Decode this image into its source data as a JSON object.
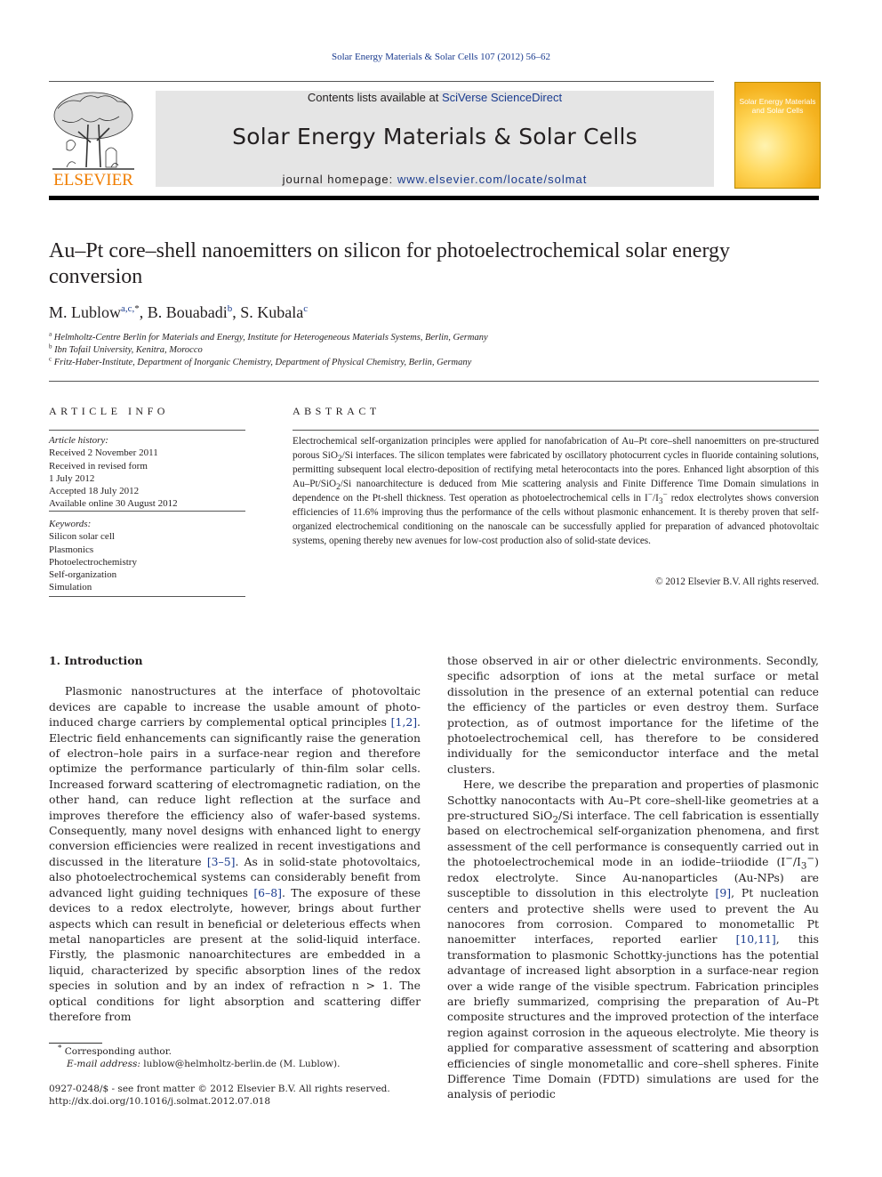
{
  "running_head": "Solar Energy Materials & Solar Cells 107 (2012) 56–62",
  "masthead": {
    "publisher_logo_text": "ELSEVIER",
    "contents_prefix": "Contents lists available at ",
    "contents_link": "SciVerse ScienceDirect",
    "journal_title": "Solar Energy Materials & Solar Cells",
    "homepage_prefix": "journal homepage: ",
    "homepage_link": "www.elsevier.com/locate/solmat",
    "cover_title_line1": "Solar Energy Materials",
    "cover_title_line2": "and Solar Cells"
  },
  "article": {
    "title": "Au–Pt core–shell nanoemitters on silicon for photoelectrochemical solar energy conversion",
    "authors": [
      {
        "name": "M. Lublow",
        "sup": "a,c,",
        "star": "*",
        "sep": ", "
      },
      {
        "name": "B. Bouabadi",
        "sup": "b",
        "star": "",
        "sep": ", "
      },
      {
        "name": "S. Kubala",
        "sup": "c",
        "star": "",
        "sep": ""
      }
    ],
    "affiliations": [
      {
        "mark": "a",
        "text": "Helmholtz-Centre Berlin for Materials and Energy, Institute for Heterogeneous Materials Systems, Berlin, Germany"
      },
      {
        "mark": "b",
        "text": "Ibn Tofail University, Kenitra, Morocco"
      },
      {
        "mark": "c",
        "text": "Fritz-Haber-Institute, Department of Inorganic Chemistry, Department of Physical Chemistry, Berlin, Germany"
      }
    ]
  },
  "article_info": {
    "heading": "ARTICLE INFO",
    "history_label": "Article history:",
    "history": [
      "Received 2 November 2011",
      "Received in revised form",
      "1 July 2012",
      "Accepted 18 July 2012",
      "Available online 30 August 2012"
    ],
    "keywords_label": "Keywords:",
    "keywords": [
      "Silicon solar cell",
      "Plasmonics",
      "Photoelectrochemistry",
      "Self-organization",
      "Simulation"
    ]
  },
  "abstract": {
    "heading": "ABSTRACT",
    "p1": "Electrochemical self-organization principles were applied for nanofabrication of Au–Pt core–shell nanoemitters on pre-structured porous SiO",
    "p2": "/Si interfaces. The silicon templates were fabricated by oscillatory photocurrent cycles in fluoride containing solutions, permitting subsequent local electro-deposition of rectifying metal heterocontacts into the pores. Enhanced light absorption of this Au–Pt/SiO",
    "p3": "/Si nanoarchitecture is deduced from Mie scattering analysis and Finite Difference Time Domain simulations in dependence on the Pt-shell thickness. Test operation as photoelectrochemical cells in I",
    "p4": "/I",
    "p5": " redox electrolytes shows conversion efficiencies of 11.6% improving thus the performance of the cells without plasmonic enhancement. It is thereby proven that self-organized electrochemical conditioning on the nanoscale can be successfully applied for preparation of advanced photovoltaic systems, opening thereby new avenues for low-cost production also of solid-state devices.",
    "sub2": "2",
    "sub3": "3",
    "sup_minus": "−",
    "copyright": "© 2012 Elsevier B.V. All rights reserved."
  },
  "body": {
    "section1_heading": "1.  Introduction",
    "left_p1a": "Plasmonic nanostructures at the interface of photovoltaic devices are capable to increase the usable amount of photo-induced charge carriers by complemental optical principles ",
    "ref_1_2": "[1,2]",
    "left_p1b": ". Electric field enhancements can significantly raise the generation of electron–hole pairs in a surface-near region and therefore optimize the performance particularly of thin-film solar cells. Increased forward scattering of electromagnetic radiation, on the other hand, can reduce light reflection at the surface and improves therefore the efficiency also of wafer-based systems. Consequently, many novel designs with enhanced light to energy conversion efficiencies were realized in recent investigations and discussed in the literature ",
    "ref_3_5": "[3–5]",
    "left_p1c": ". As in solid-state photovoltaics, also photoelectrochemical systems can considerably benefit from advanced light guiding techniques ",
    "ref_6_8": "[6–8]",
    "left_p1d": ". The exposure of these devices to a redox electrolyte, however, brings about further aspects which can result in beneficial or deleterious effects when metal nanoparticles are present at the solid-liquid interface. Firstly, the plasmonic nanoarchitectures are embedded in a liquid, characterized by specific absorption lines of the redox species in solution and by an index of refraction n > 1. The optical conditions for light absorption and scattering differ therefore from",
    "right_p1": "those observed in air or other dielectric environments. Secondly, specific adsorption of ions at the metal surface or metal dissolution in the presence of an external potential can reduce the efficiency of the particles or even destroy them. Surface protection, as of outmost importance for the lifetime of the photoelectrochemical cell, has therefore to be considered individually for the semiconductor interface and the metal clusters.",
    "right_p2a": "Here, we describe the preparation and properties of plasmonic Schottky nanocontacts with Au–Pt core–shell-like geometries at a pre-structured SiO",
    "right_p2b": "/Si interface. The cell fabrication is essentially based on electrochemical self-organization phenomena, and first assessment of the cell performance is consequently carried out in the photoelectrochemical mode in an iodide–triiodide (I",
    "right_p2c": "/I",
    "right_p2d": ") redox electrolyte. Since Au-nanoparticles (Au-NPs) are susceptible to dissolution in this electrolyte ",
    "ref_9": "[9]",
    "right_p2e": ", Pt nucleation centers and protective shells were used to prevent the Au nanocores from corrosion. Compared to monometallic Pt nanoemitter interfaces, reported earlier ",
    "ref_10_11": "[10,11]",
    "right_p2f": ", this transformation to plasmonic Schottky-junctions has the potential advantage of increased light absorption in a surface-near region over a wide range of the visible spectrum. Fabrication principles are briefly summarized, comprising the preparation of Au–Pt composite structures and the improved protection of the interface region against corrosion in the aqueous electrolyte. Mie theory is applied for comparative assessment of scattering and absorption efficiencies of single monometallic and core–shell spheres. Finite Difference Time Domain (FDTD) simulations are used for the analysis of periodic"
  },
  "footnote": {
    "star": "*",
    "corresponding": " Corresponding author.",
    "email_label": "E-mail address:",
    "email": " lublow@helmholtz-berlin.de (M. Lublow)."
  },
  "issn_line": "0927-0248/$ - see front matter © 2012 Elsevier B.V. All rights reserved.",
  "doi_line": "http://dx.doi.org/10.1016/j.solmat.2012.07.018"
}
